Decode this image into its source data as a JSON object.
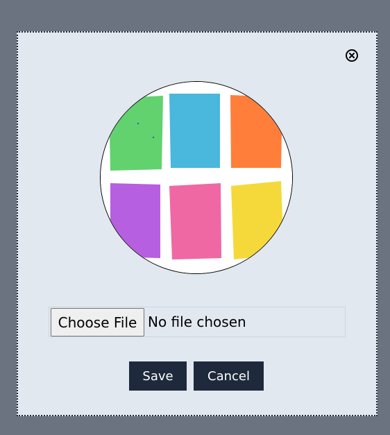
{
  "modal": {
    "close_icon": "close-circle-icon",
    "avatar_image": "sticky-notes-image",
    "sticky_note_colors": [
      "#62d26f",
      "#4ab7dc",
      "#ff7f3a",
      "#b65fe0",
      "#ef68a3",
      "#f5d93a"
    ]
  },
  "file_input": {
    "button_label": "Choose File",
    "status": "No file chosen"
  },
  "actions": {
    "save_label": "Save",
    "cancel_label": "Cancel"
  }
}
